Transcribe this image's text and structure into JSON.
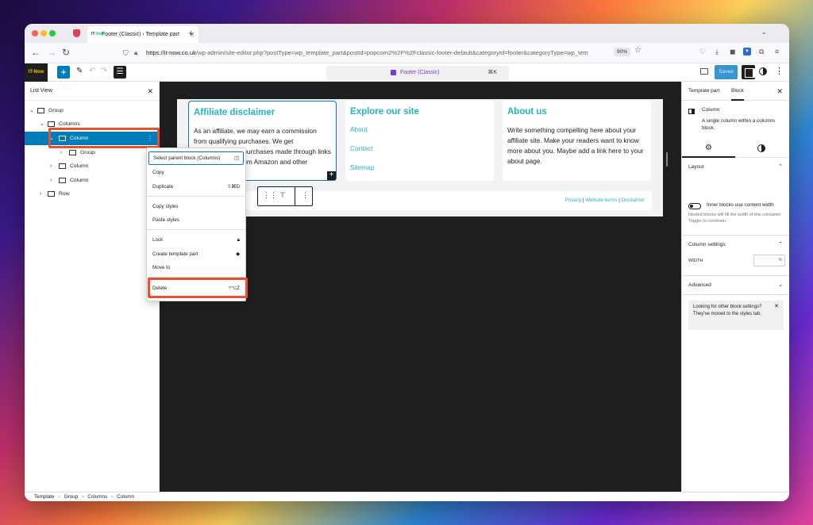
{
  "browser": {
    "tab_title": "Footer (Classic) ‹ Template part",
    "tab_favicon_prefix": "IT",
    "tab_favicon_suffix": "-Now",
    "url_host": "https://it-now.co.uk",
    "url_path": "/wp-admin/site-editor.php?postType=wp_template_part&postId=popcorn2%2F%2Fclassic-footer-default&categoryId=footer&categoryType=wp_tem",
    "zoom": "90%"
  },
  "wp_toolbar": {
    "site_logo": "IT-Now",
    "document_title": "Footer (Classic)",
    "command_shortcut": "⌘K",
    "saved_label": "Saved"
  },
  "list_view": {
    "title": "List View",
    "items": [
      {
        "label": "Group"
      },
      {
        "label": "Columns"
      },
      {
        "label": "Column"
      },
      {
        "label": "Group"
      },
      {
        "label": "Column"
      },
      {
        "label": "Column"
      },
      {
        "label": "Row"
      }
    ]
  },
  "context_menu": {
    "items": [
      {
        "label": "Select parent block (Columns)"
      },
      {
        "label": "Copy"
      },
      {
        "label": "Duplicate",
        "shortcut": "⇧⌘D"
      },
      {
        "label": "Copy styles"
      },
      {
        "label": "Paste styles"
      },
      {
        "label": "Lock"
      },
      {
        "label": "Create template part"
      },
      {
        "label": "Move to"
      },
      {
        "label": "Delete",
        "shortcut": "^⌥Z"
      }
    ]
  },
  "canvas": {
    "col1": {
      "heading": "Affiliate disclaimer",
      "text": "As an affiliate, we may earn a commission from qualifying purchases. We get commissions for purchases made through links on this website from Amazon and other"
    },
    "col2": {
      "heading": "Explore our site",
      "links": [
        "About",
        "Contact",
        "Sitemap"
      ]
    },
    "col3": {
      "heading": "About us",
      "text": "Write something compelling here about your affiliate site. Make your readers want to know more about you. Maybe add a link here to your about page."
    },
    "bottom_links": [
      "Privacy",
      "Website terms",
      "Disclaimer"
    ],
    "bottom_sep": "|"
  },
  "sidebar": {
    "tabs": [
      "Template part",
      "Block"
    ],
    "block_name": "Column",
    "block_desc": "A single column within a columns block.",
    "layout_title": "Layout",
    "toggle_label": "Inner blocks use content width",
    "toggle_help": "Nested blocks will fill the width of this container. Toggle to constrain.",
    "column_settings_title": "Column settings",
    "width_label": "Width",
    "width_unit": "%",
    "advanced_title": "Advanced",
    "notice": "Looking for other block settings? They've moved to the styles tab."
  },
  "breadcrumb": [
    "Template",
    "Group",
    "Columns",
    "Column"
  ]
}
